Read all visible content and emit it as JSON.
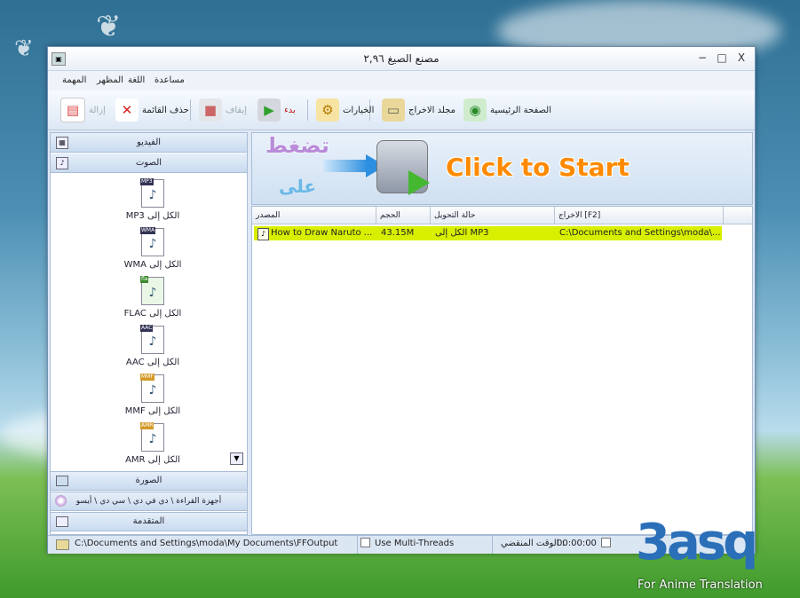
{
  "window": {
    "title": "مصنع الصيغ ٢,٩٦",
    "minimize": "−",
    "maximize": "□",
    "close": "X"
  },
  "menu": [
    "مساعدة",
    "اللغة",
    "المظهر",
    "المهمة"
  ],
  "toolbar": {
    "home": "الصفحة الرئيسية",
    "output_folder": "مجلد الاخراج",
    "options": "الخيارات",
    "start": "بدء",
    "stop": "إيقاف",
    "clear_list": "حذف القائمة",
    "remove": "إزالة"
  },
  "sidebar": {
    "video": "الفيديو",
    "audio": "الصوت",
    "formats": [
      {
        "tag": "MP3",
        "label": "MP3 الكل إلى"
      },
      {
        "tag": "WMA",
        "label": "WMA الكل إلى"
      },
      {
        "tag": "fla",
        "label": "FLAC الكل إلى"
      },
      {
        "tag": "AAC",
        "label": "AAC الكل إلى"
      },
      {
        "tag": "MMF",
        "label": "MMF الكل إلى"
      },
      {
        "tag": "AMR",
        "label": "AMR الكل إلى"
      }
    ],
    "picture": "الصورة",
    "rom": "أجهزة القراءة \\ دي في دي \\ سي دي \\ أيسو",
    "advanced": "المتقدمة"
  },
  "banner": {
    "arabic_1": "تضغط",
    "arabic_2": "على",
    "click_to_start": "Click to Start"
  },
  "list": {
    "headers": [
      "المصدر",
      "الحجم",
      "حالة التحويل",
      "الاخراج [F2]"
    ],
    "rows": [
      {
        "source": "How to Draw Naruto ...",
        "size": "43.15M",
        "status": "الكل إلى MP3",
        "output": "C:\\Documents and Settings\\moda\\..."
      }
    ]
  },
  "status": {
    "output_path": "C:\\Documents and Settings\\moda\\My Documents\\FFOutput",
    "multi_threads": "Use Multi-Threads",
    "elapsed_label": "الوقت المنقضي :",
    "elapsed_value": "00:00:00"
  },
  "watermark": {
    "logo": "3asq",
    "subtitle": "For Anime Translation"
  }
}
